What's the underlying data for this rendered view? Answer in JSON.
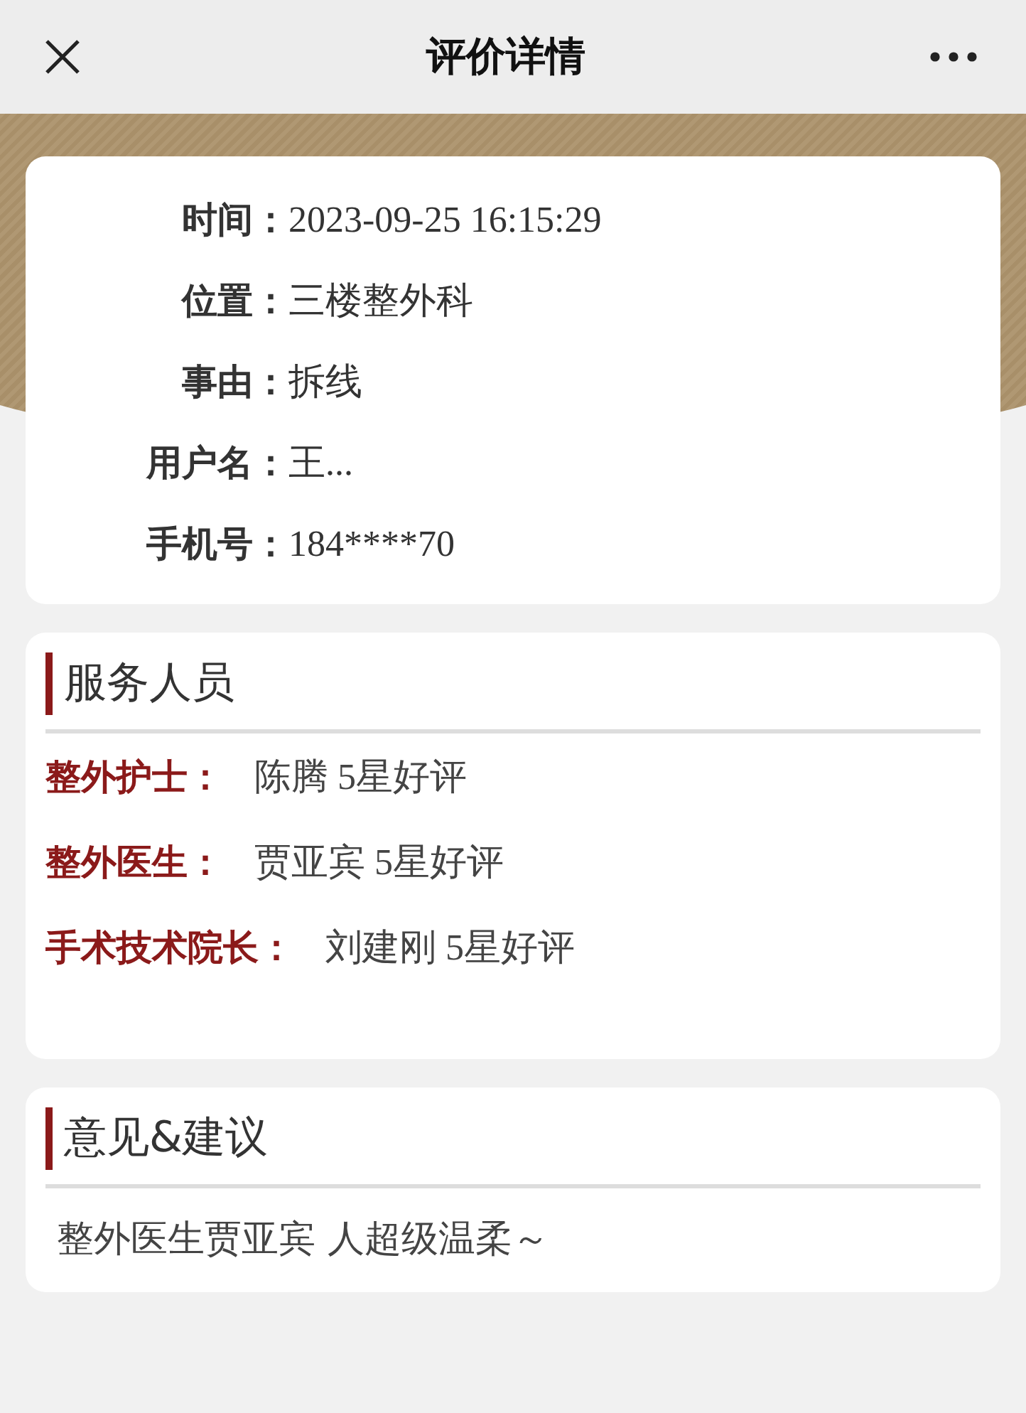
{
  "header": {
    "title": "评价详情"
  },
  "info": [
    {
      "label": "时间：",
      "value": "2023-09-25 16:15:29"
    },
    {
      "label": "位置：",
      "value": "三楼整外科"
    },
    {
      "label": "事由：",
      "value": "拆线"
    },
    {
      "label": "用户名：",
      "value": "王..."
    },
    {
      "label": "手机号：",
      "value": "184****70"
    }
  ],
  "staff": {
    "title": "服务人员",
    "items": [
      {
        "label": "整外护士：",
        "value": "陈腾 5星好评"
      },
      {
        "label": "整外医生：",
        "value": "贾亚宾 5星好评"
      },
      {
        "label": "手术技术院长：",
        "value": "刘建刚 5星好评"
      }
    ]
  },
  "suggestion": {
    "title": "意见&建议",
    "text": "整外医生贾亚宾 人超级温柔～"
  }
}
